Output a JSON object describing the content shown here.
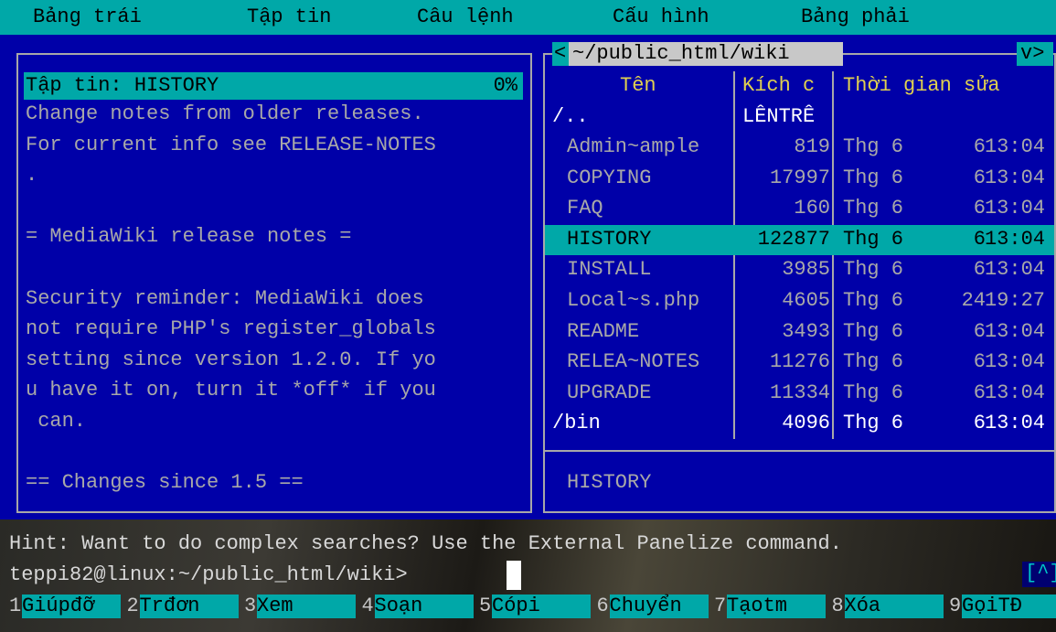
{
  "menu": [
    "Bảng trái",
    "Tập tin",
    "Câu lệnh",
    "Cấu hình",
    "Bảng phải"
  ],
  "viewer": {
    "header": "Tập tin: HISTORY",
    "percent": "0%",
    "lines": [
      "Change notes from older releases.",
      "For current info see RELEASE-NOTES",
      ".",
      "",
      "= MediaWiki release notes =",
      "",
      "Security reminder: MediaWiki does",
      "not require PHP's register_globals",
      "setting since version 1.2.0. If yo",
      "u have it on, turn it *off* if you",
      " can.",
      "",
      "== Changes since 1.5 =="
    ]
  },
  "right_panel": {
    "path": "~/public_html/wiki",
    "left_arrow": "<",
    "right_arrow": "v>",
    "columns": {
      "name": "Tên",
      "size": "Kích c",
      "mtime": "Thời gian sửa"
    },
    "updir": {
      "name": "/..",
      "size": "LÊNTRÊ"
    },
    "files": [
      {
        "name": "Admin~ample",
        "size": "819",
        "month": "Thg 6",
        "day": "6",
        "time": "13:04"
      },
      {
        "name": "COPYING",
        "size": "17997",
        "month": "Thg 6",
        "day": "6",
        "time": "13:04"
      },
      {
        "name": "FAQ",
        "size": "160",
        "month": "Thg 6",
        "day": "6",
        "time": "13:04"
      },
      {
        "name": "HISTORY",
        "size": "122877",
        "month": "Thg 6",
        "day": "6",
        "time": "13:04"
      },
      {
        "name": "INSTALL",
        "size": "3985",
        "month": "Thg 6",
        "day": "6",
        "time": "13:04"
      },
      {
        "name": "Local~s.php",
        "size": "4605",
        "month": "Thg 6",
        "day": "24",
        "time": "19:27"
      },
      {
        "name": "README",
        "size": "3493",
        "month": "Thg 6",
        "day": "6",
        "time": "13:04"
      },
      {
        "name": "RELEA~NOTES",
        "size": "11276",
        "month": "Thg 6",
        "day": "6",
        "time": "13:04"
      },
      {
        "name": "UPGRADE",
        "size": "11334",
        "month": "Thg 6",
        "day": "6",
        "time": "13:04"
      },
      {
        "name": "/bin",
        "size": "4096",
        "month": "Thg 6",
        "day": "6",
        "time": "13:04"
      }
    ],
    "selected_index": 3,
    "status": "HISTORY"
  },
  "hint": "Hint: Want to do complex searches? Use the External Panelize command.",
  "prompt": "teppi82@linux:~/public_html/wiki>",
  "prompt_right": "[^]",
  "fkeys": [
    {
      "num": "1",
      "label": "Giúpđỡ"
    },
    {
      "num": "2",
      "label": "Trđơn"
    },
    {
      "num": "3",
      "label": "Xem"
    },
    {
      "num": "4",
      "label": "Soạn"
    },
    {
      "num": "5",
      "label": "Cópi"
    },
    {
      "num": "6",
      "label": "Chuyển"
    },
    {
      "num": "7",
      "label": "Tạotm"
    },
    {
      "num": "8",
      "label": "Xóa"
    },
    {
      "num": "9",
      "label": "GọiTĐ"
    }
  ],
  "colors": {
    "panel_bg": "#0000a8",
    "accent": "#00a8a8",
    "text": "#a8a8a8",
    "header": "#e0d050",
    "dir": "#ffffff"
  }
}
